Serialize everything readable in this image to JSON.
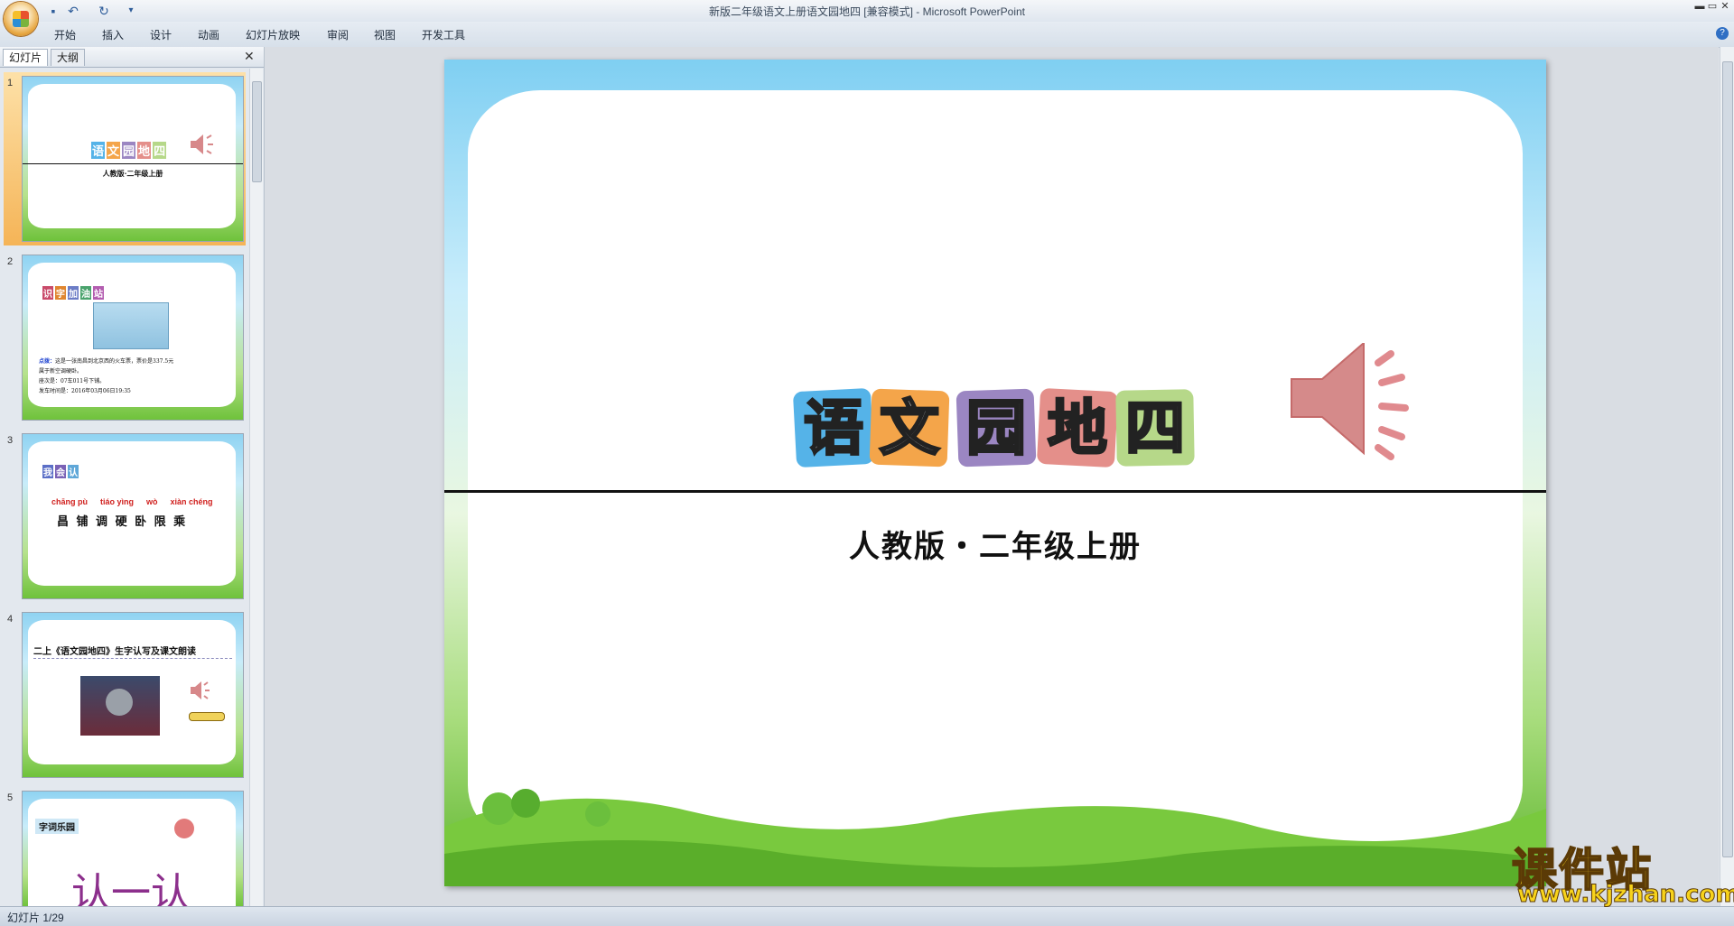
{
  "window": {
    "title": "新版二年级语文上册语文园地四 [兼容模式] - Microsoft PowerPoint",
    "controls": {
      "minimize": "▬",
      "restore": "▭",
      "close": "✕"
    }
  },
  "quick_access": {
    "save": "💾",
    "undo": "↶",
    "redo": "↻",
    "more": "▾"
  },
  "ribbon": {
    "tabs": [
      "开始",
      "插入",
      "设计",
      "动画",
      "幻灯片放映",
      "审阅",
      "视图",
      "开发工具"
    ],
    "help": "?"
  },
  "left_pane": {
    "tabs": {
      "slides": "幻灯片",
      "outline": "大纲"
    },
    "close": "✕",
    "thumbnails": [
      {
        "number": "1",
        "title_tiles": [
          "语",
          "文",
          "园",
          "地",
          "四"
        ],
        "subtitle": "人教版·二年级上册"
      },
      {
        "number": "2",
        "heading": [
          "识",
          "字",
          "加",
          "油",
          "站"
        ],
        "label": "点拨：",
        "lines": [
          "这是一张南昌到北京西的火车票，票价是337.5元",
          "属于新空调硬卧。",
          "座次是：07车011号下铺。",
          "发车时间是：2016年03月06日19:35"
        ]
      },
      {
        "number": "3",
        "heading": [
          "我",
          "会",
          "认"
        ],
        "pinyin": [
          "chāng pù",
          "tiáo yìng",
          "wò",
          "xiàn chéng"
        ],
        "chars": "昌 铺 调 硬 卧 限 乘"
      },
      {
        "number": "4",
        "title": "二上《语文园地四》生字认写及课文朗读"
      },
      {
        "number": "5",
        "label": "字词乐园",
        "text": "认一认"
      }
    ]
  },
  "slide": {
    "tiles": [
      {
        "char": "语",
        "color": "#55b3e8"
      },
      {
        "char": "文",
        "color": "#f4a54a"
      },
      {
        "char": "园",
        "color": "#9b86c2"
      },
      {
        "char": "地",
        "color": "#e48f8a"
      },
      {
        "char": "四",
        "color": "#b6d889"
      }
    ],
    "subtitle": "人教版・二年级上册",
    "speaker_icon": "speaker-icon"
  },
  "status": {
    "text": "幻灯片 1/29"
  },
  "watermark": {
    "main": "课件站",
    "url": "www.kjzhan.com"
  }
}
